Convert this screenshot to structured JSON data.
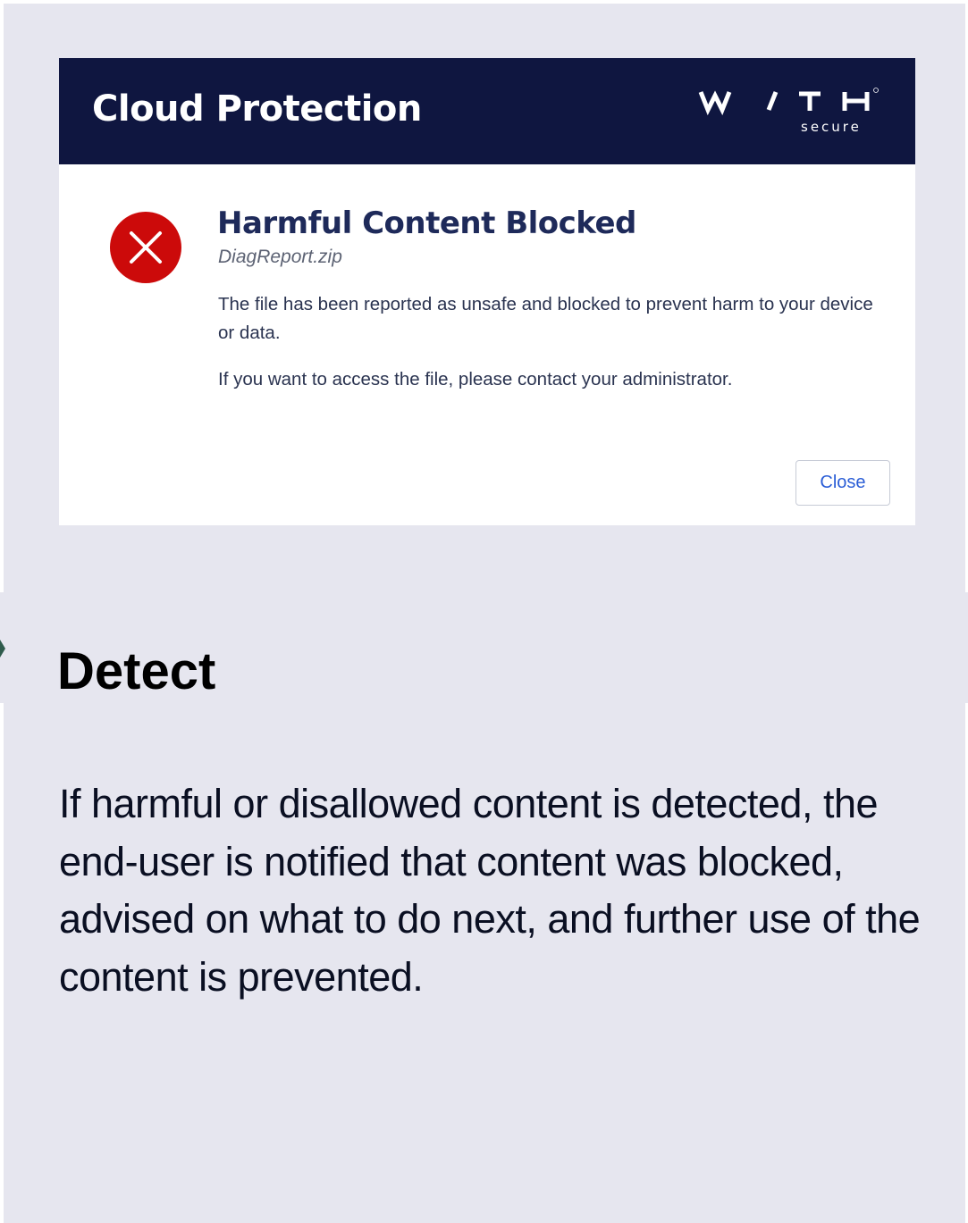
{
  "dialog": {
    "header_title": "Cloud Protection",
    "logo_text": "W/TH",
    "logo_subtext": "secure",
    "header_color": "#0f1640",
    "title": "Harmful Content Blocked",
    "file_name": "DiagReport.zip",
    "message": "The file has been reported as unsafe and blocked to prevent harm to your device or data.",
    "message_secondary": "If you want to access the file, please contact your administrator.",
    "close_label": "Close",
    "error_icon_color": "#cc0a0a",
    "icon": "error-x-icon"
  },
  "section": {
    "heading": "Detect",
    "description": "If harmful or disallowed content is detected, the end-user is notified that content was blocked, advised on what to do next, and further use of the content is prevented."
  }
}
